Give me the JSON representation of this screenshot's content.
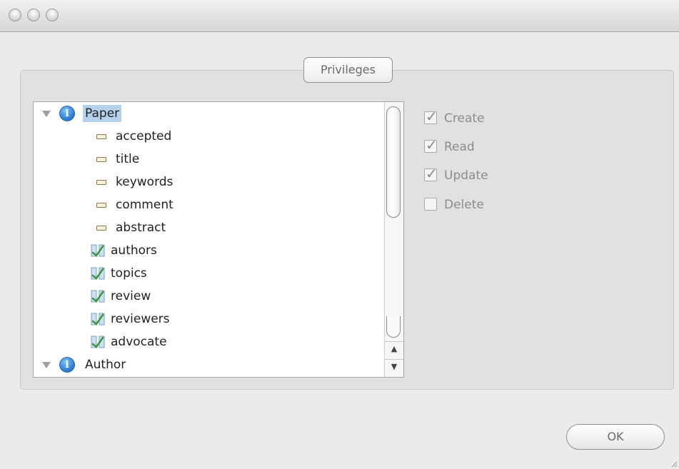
{
  "window": {
    "controls": [
      "close",
      "minimize",
      "zoom"
    ]
  },
  "group": {
    "title": "Privileges"
  },
  "tree": {
    "items": [
      {
        "label": "Paper",
        "kind": "entity",
        "icon": "info-icon",
        "expanded": true,
        "selected": true
      },
      {
        "label": "accepted",
        "kind": "attribute",
        "icon": "attribute-icon"
      },
      {
        "label": "title",
        "kind": "attribute",
        "icon": "attribute-icon"
      },
      {
        "label": "keywords",
        "kind": "attribute",
        "icon": "attribute-icon"
      },
      {
        "label": "comment",
        "kind": "attribute",
        "icon": "attribute-icon"
      },
      {
        "label": "abstract",
        "kind": "attribute",
        "icon": "attribute-icon"
      },
      {
        "label": "authors",
        "kind": "relationship",
        "icon": "relationship-icon"
      },
      {
        "label": "topics",
        "kind": "relationship",
        "icon": "relationship-icon"
      },
      {
        "label": "review",
        "kind": "relationship",
        "icon": "relationship-icon"
      },
      {
        "label": "reviewers",
        "kind": "relationship",
        "icon": "relationship-icon"
      },
      {
        "label": "advocate",
        "kind": "relationship",
        "icon": "relationship-icon"
      },
      {
        "label": "Author",
        "kind": "entity",
        "icon": "info-icon",
        "expanded": true
      }
    ]
  },
  "permissions": {
    "create": {
      "label": "Create",
      "checked": true
    },
    "read": {
      "label": "Read",
      "checked": true
    },
    "update": {
      "label": "Update",
      "checked": true
    },
    "delete": {
      "label": "Delete",
      "checked": false
    }
  },
  "footer": {
    "ok_label": "OK"
  },
  "colors": {
    "selection": "#b6d1ee",
    "info_icon": "#2a7ed3",
    "disabled_text": "#8c8c8c"
  }
}
